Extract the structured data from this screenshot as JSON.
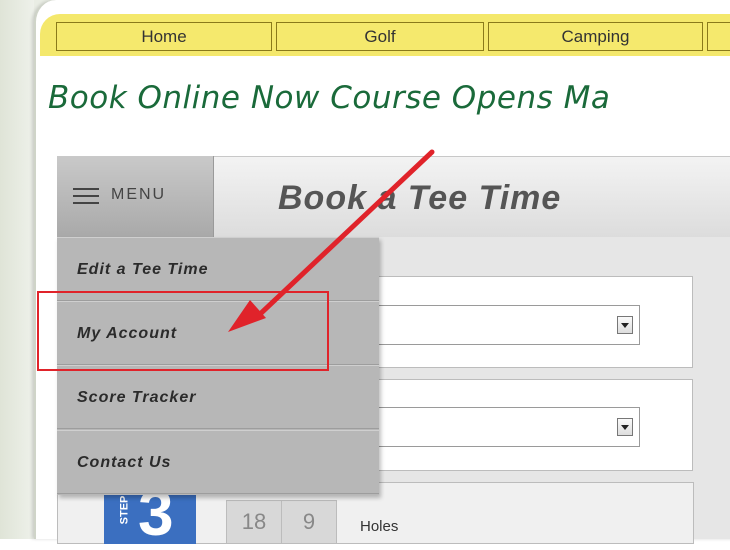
{
  "nav": {
    "items": [
      "Home",
      "Golf",
      "Camping",
      ""
    ]
  },
  "headline": "Book Online Now Course Opens Ma",
  "header": {
    "menu_label": "MENU",
    "title": "Book a Tee Time"
  },
  "menu": {
    "items": [
      "Edit a Tee Time",
      "My Account",
      "Score Tracker",
      "Contact Us"
    ],
    "highlighted": "My Account"
  },
  "step3": {
    "label": "STEP",
    "number": "3",
    "holes_options": [
      "18",
      "9"
    ],
    "holes_label": "Holes"
  },
  "colors": {
    "nav_yellow": "#f5e96d",
    "headline_green": "#1a6a3a",
    "highlight_red": "#e0232a",
    "step_blue": "#3b6fc0"
  }
}
